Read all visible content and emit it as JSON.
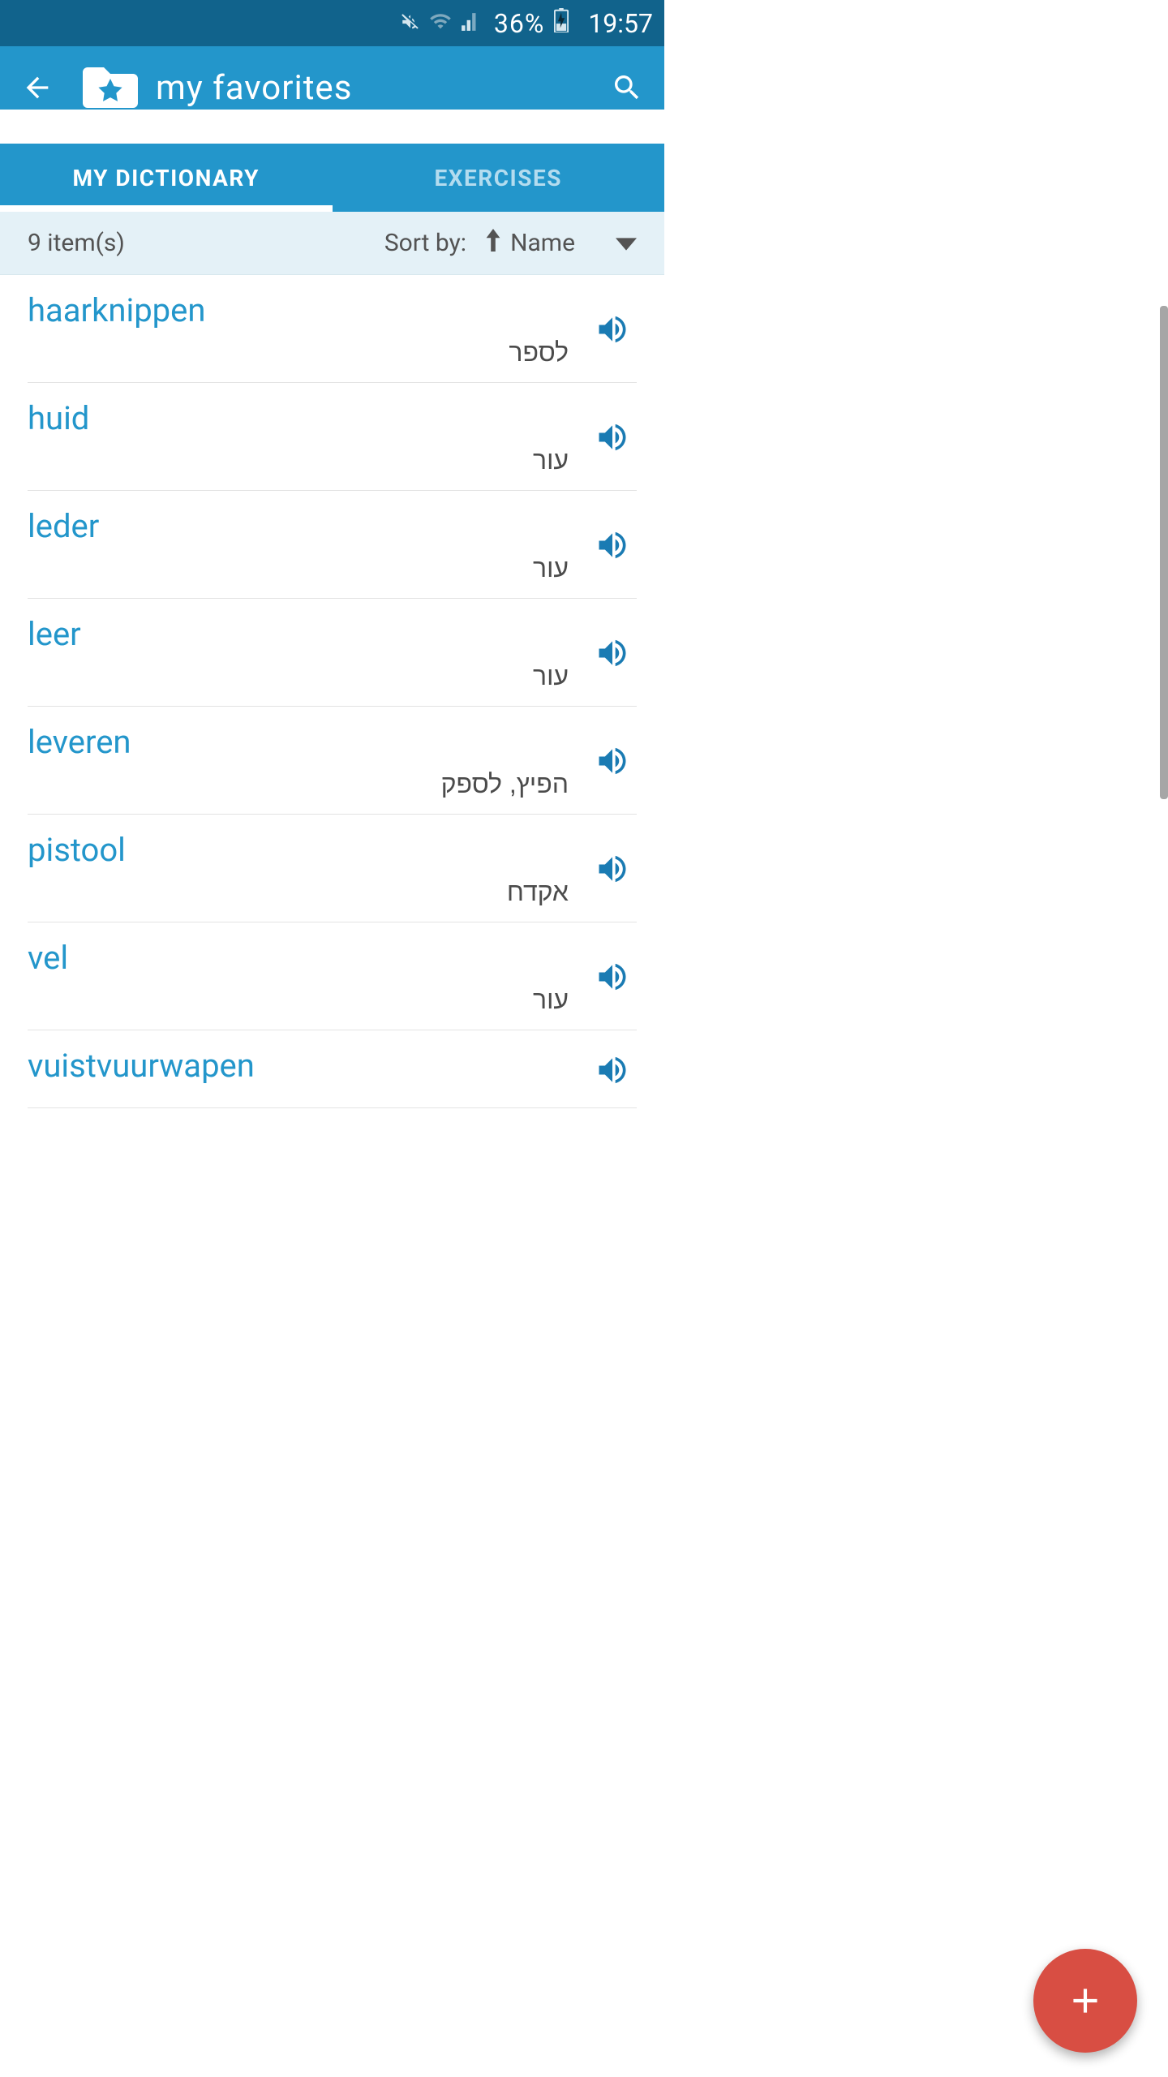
{
  "status_bar": {
    "battery_pct": "36%",
    "time": "19:57"
  },
  "header": {
    "title": "my favorites"
  },
  "tabs": [
    {
      "label": "MY DICTIONARY",
      "active": true
    },
    {
      "label": "EXERCISES",
      "active": false
    }
  ],
  "sort_bar": {
    "count_text": "9 item(s)",
    "sort_by_label": "Sort by:",
    "sort_value": "Name"
  },
  "items": [
    {
      "term": "haarknippen",
      "translation": "לספר"
    },
    {
      "term": "huid",
      "translation": "עור"
    },
    {
      "term": "leder",
      "translation": "עור"
    },
    {
      "term": "leer",
      "translation": "עור"
    },
    {
      "term": "leveren",
      "translation": "הפיץ, לספק"
    },
    {
      "term": "pistool",
      "translation": "אקדח"
    },
    {
      "term": "vel",
      "translation": "עור"
    },
    {
      "term": "vuistvuurwapen",
      "translation": ""
    }
  ],
  "colors": {
    "status_bar_bg": "#11638c",
    "app_bar_bg": "#2396cb",
    "accent": "#2396cb",
    "fab": "#d84e43"
  }
}
